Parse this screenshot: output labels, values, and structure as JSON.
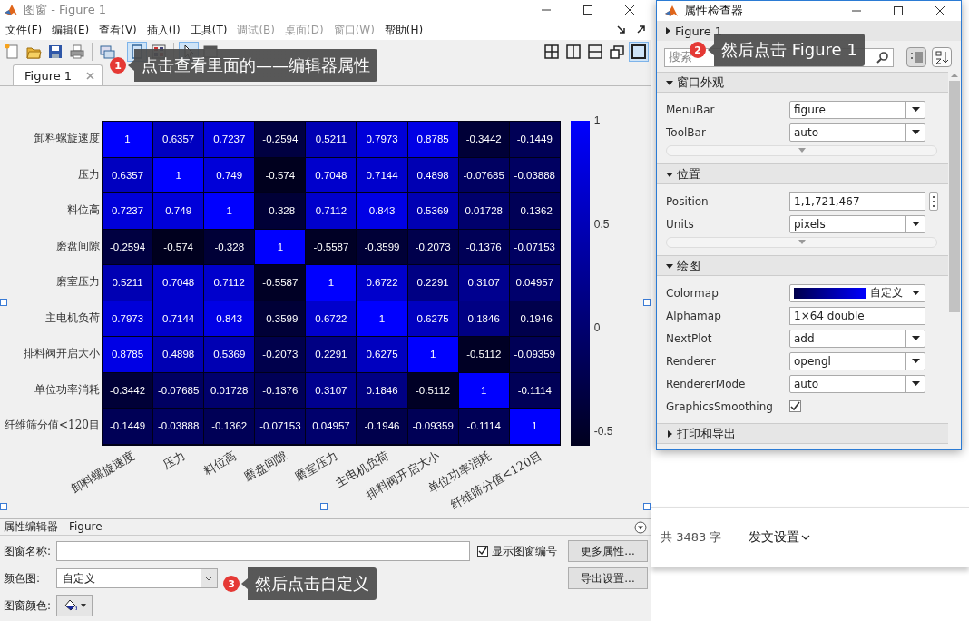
{
  "figure_window": {
    "title": "图窗 - Figure 1",
    "menus": [
      {
        "label": "文件(F)",
        "disabled": false
      },
      {
        "label": "编辑(E)",
        "disabled": false
      },
      {
        "label": "查看(V)",
        "disabled": false
      },
      {
        "label": "插入(I)",
        "disabled": false
      },
      {
        "label": "工具(T)",
        "disabled": false
      },
      {
        "label": "调试(B)",
        "disabled": true
      },
      {
        "label": "桌面(D)",
        "disabled": true
      },
      {
        "label": "窗口(W)",
        "disabled": true
      },
      {
        "label": "帮助(H)",
        "disabled": false
      }
    ],
    "toolbar": [
      {
        "kind": "new",
        "selected": false
      },
      {
        "kind": "open",
        "selected": false
      },
      {
        "kind": "save",
        "selected": false
      },
      {
        "kind": "print",
        "selected": false
      },
      {
        "kind": "link",
        "selected": false
      },
      {
        "kind": "editor",
        "selected": true
      },
      {
        "kind": "palette",
        "selected": false
      },
      {
        "kind": "pointer",
        "selected": true
      },
      {
        "kind": "dock",
        "selected": false
      }
    ],
    "layout_buttons": [
      {
        "kind": "grid",
        "selected": false
      },
      {
        "kind": "columns",
        "selected": false
      },
      {
        "kind": "rows",
        "selected": false
      },
      {
        "kind": "undock",
        "selected": false
      },
      {
        "kind": "single",
        "selected": true
      }
    ],
    "tab": {
      "label": "Figure 1"
    },
    "heatmap": {
      "row_labels": [
        "卸料螺旋速度",
        "压力",
        "料位高",
        "磨盘间隙",
        "磨室压力",
        "主电机负荷",
        "排料阀开启大小",
        "单位功率消耗",
        "纤维筛分值<120目"
      ],
      "column_labels": [
        "卸料螺旋速度",
        "压力",
        "料位高",
        "磨盘间隙",
        "磨室压力",
        "主电机负荷",
        "排料阀开启大小",
        "单位功率消耗",
        "纤维筛分值<120目"
      ],
      "rows": [
        [
          "1",
          "0.6357",
          "0.7237",
          "-0.2594",
          "0.5211",
          "0.7973",
          "0.8785",
          "-0.3442",
          "-0.1449"
        ],
        [
          "0.6357",
          "1",
          "0.749",
          "-0.574",
          "0.7048",
          "0.7144",
          "0.4898",
          "-0.07685",
          "-0.03888"
        ],
        [
          "0.7237",
          "0.749",
          "1",
          "-0.328",
          "0.7112",
          "0.843",
          "0.5369",
          "0.01728",
          "-0.1362"
        ],
        [
          "-0.2594",
          "-0.574",
          "-0.328",
          "1",
          "-0.5587",
          "-0.3599",
          "-0.2073",
          "-0.1376",
          "-0.07153"
        ],
        [
          "0.5211",
          "0.7048",
          "0.7112",
          "-0.5587",
          "1",
          "0.6722",
          "0.2291",
          "0.3107",
          "0.04957"
        ],
        [
          "0.7973",
          "0.7144",
          "0.843",
          "-0.3599",
          "0.6722",
          "1",
          "0.6275",
          "0.1846",
          "-0.1946"
        ],
        [
          "0.8785",
          "0.4898",
          "0.5369",
          "-0.2073",
          "0.2291",
          "0.6275",
          "1",
          "-0.5112",
          "-0.09359"
        ],
        [
          "-0.3442",
          "-0.07685",
          "0.01728",
          "-0.1376",
          "0.3107",
          "0.1846",
          "-0.5112",
          "1",
          "-0.1114"
        ],
        [
          "-0.1449",
          "-0.03888",
          "-0.1362",
          "-0.07153",
          "0.04957",
          "-0.1946",
          "-0.09359",
          "-0.1114",
          "1"
        ]
      ],
      "colorbar_ticks": [
        "1",
        "0.5",
        "0",
        "-0.5"
      ]
    },
    "property_editor": {
      "title": "属性编辑器 - Figure",
      "name_label": "图窗名称:",
      "show_number_label": "显示图窗编号",
      "show_number_checked": true,
      "more_button": "更多属性...",
      "colormap_label": "颜色图:",
      "colormap_value": "自定义",
      "export_button": "导出设置...",
      "color_label": "图窗颜色:"
    }
  },
  "inspector": {
    "title": "属性检查器",
    "object": "Figure 1",
    "object_expanded": false,
    "search_placeholder": "搜索",
    "view_buttons": [
      {
        "kind": "categorized",
        "selected": true
      },
      {
        "kind": "alphabetical",
        "selected": false
      }
    ],
    "sections": [
      {
        "title": "窗口外观",
        "expanded": true,
        "more": true,
        "rows": [
          {
            "label": "MenuBar",
            "kind": "dropdown",
            "value": "figure"
          },
          {
            "label": "ToolBar",
            "kind": "dropdown",
            "value": "auto"
          }
        ]
      },
      {
        "title": "位置",
        "expanded": true,
        "more": true,
        "rows": [
          {
            "label": "Position",
            "kind": "text_button",
            "value": "1,1,721,467"
          },
          {
            "label": "Units",
            "kind": "dropdown",
            "value": "pixels"
          }
        ]
      },
      {
        "title": "绘图",
        "expanded": true,
        "more": false,
        "rows": [
          {
            "label": "Colormap",
            "kind": "colormap",
            "value": "自定义"
          },
          {
            "label": "Alphamap",
            "kind": "text",
            "value": "1×64 double"
          },
          {
            "label": "NextPlot",
            "kind": "dropdown",
            "value": "add"
          },
          {
            "label": "Renderer",
            "kind": "dropdown",
            "value": "opengl"
          },
          {
            "label": "RendererMode",
            "kind": "dropdown",
            "value": "auto"
          },
          {
            "label": "GraphicsSmoothing",
            "kind": "checkbox",
            "checked": true
          }
        ]
      },
      {
        "title": "打印和导出",
        "expanded": false,
        "more": false
      }
    ]
  },
  "page_behind": {
    "word_count": "共 3483 字",
    "publish_settings": "发文设置"
  },
  "callouts": [
    {
      "number": "1",
      "text": "点击查看里面的——编辑器属性"
    },
    {
      "number": "2",
      "text": "然后点击 Figure 1"
    },
    {
      "number": "3",
      "text": "然后点击自定义"
    }
  ]
}
